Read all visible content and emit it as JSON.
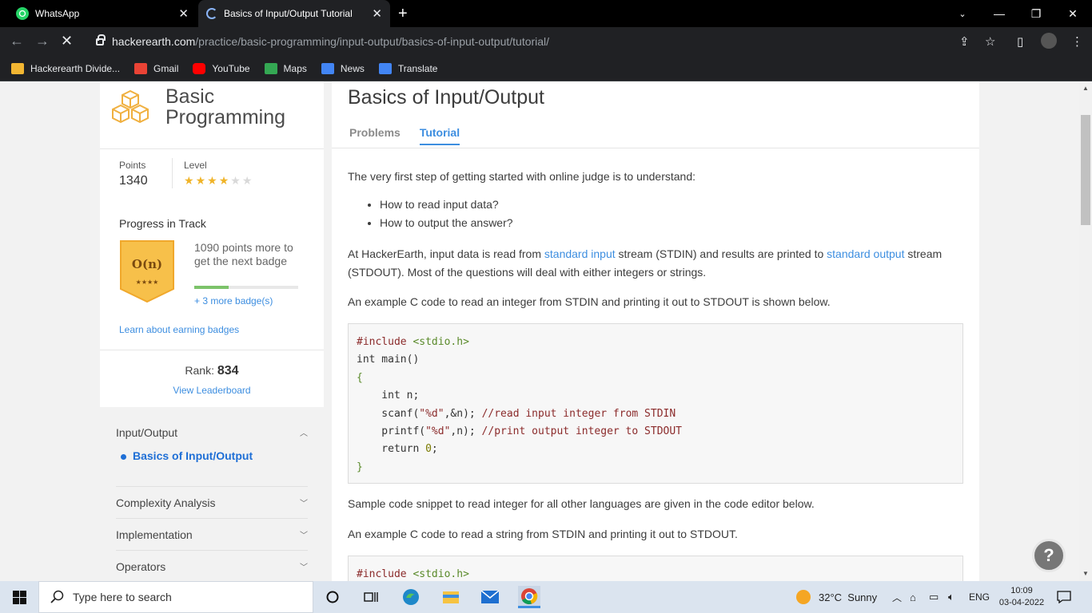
{
  "browser": {
    "tabs": [
      {
        "title": "WhatsApp",
        "icon": "whatsapp-icon"
      },
      {
        "title": "Basics of Input/Output Tutorials &",
        "icon": "loading-spinner-icon"
      }
    ],
    "url_domain": "hackerearth.com",
    "url_path": "/practice/basic-programming/input-output/basics-of-input-output/tutorial/",
    "bookmarks": [
      {
        "label": "Hackerearth Divide...",
        "color": "#f2b632"
      },
      {
        "label": "Gmail",
        "color": "#ea4335"
      },
      {
        "label": "YouTube",
        "color": "#ff0000"
      },
      {
        "label": "Maps",
        "color": "#34a853"
      },
      {
        "label": "News",
        "color": "#4285f4"
      },
      {
        "label": "Translate",
        "color": "#4285f4"
      }
    ]
  },
  "sidebar": {
    "track_title_line1": "Basic",
    "track_title_line2": "Programming",
    "points_label": "Points",
    "points_value": "1340",
    "level_label": "Level",
    "level_stars_filled": 4,
    "level_stars_total": 6,
    "progress_title": "Progress in Track",
    "badge_text": "O(n)",
    "badge_stars": "★★★★",
    "points_more": "1090 points more to get the next badge",
    "progress_fraction": 0.33,
    "more_badges": "+ 3 more badge(s)",
    "learn_badges": "Learn about earning badges",
    "rank_label": "Rank:",
    "rank_value": "834",
    "view_leaderboard": "View Leaderboard",
    "topics": [
      {
        "label": "Input/Output",
        "expanded": true,
        "subtopic": "Basics of Input/Output"
      },
      {
        "label": "Complexity Analysis",
        "expanded": false
      },
      {
        "label": "Implementation",
        "expanded": false
      },
      {
        "label": "Operators",
        "expanded": false
      }
    ]
  },
  "main": {
    "title": "Basics of Input/Output",
    "tab_problems": "Problems",
    "tab_tutorial": "Tutorial",
    "intro": "The very first step of getting started with online judge is to understand:",
    "bullets": [
      "How to read input data?",
      "How to output the answer?"
    ],
    "p1_a": "At HackerEarth, input data is read from ",
    "p1_link1": "standard input",
    "p1_b": " stream (STDIN) and results are printed to ",
    "p1_link2": "standard output",
    "p1_c": " stream (STDOUT). Most of the questions will deal with either integers or strings.",
    "p2": "An example C code to read an integer from STDIN and printing it out to STDOUT is shown below.",
    "code1": {
      "l1a": "#include ",
      "l1b": "<stdio.h>",
      "l2": "int main()",
      "l3": "{",
      "l4": "    int n;",
      "l5a": "    scanf(",
      "l5b": "\"%d\"",
      "l5c": ",&n); ",
      "l5d": "//read input integer from STDIN",
      "l6a": "    printf(",
      "l6b": "\"%d\"",
      "l6c": ",n); ",
      "l6d": "//print output integer to STDOUT",
      "l7a": "    return ",
      "l7b": "0",
      "l7c": ";",
      "l8": "}"
    },
    "p3": "Sample code snippet to read integer for all other languages are given in the code editor below.",
    "p4": "An example C code to read a string from STDIN and printing it out to STDOUT.",
    "code2_l1a": "#include ",
    "code2_l1b": "<stdio.h>",
    "help": "?"
  },
  "taskbar": {
    "search_placeholder": "Type here to search",
    "weather": "32°C  Sunny",
    "lang": "ENG",
    "time": "10:09",
    "date": "03-04-2022"
  }
}
